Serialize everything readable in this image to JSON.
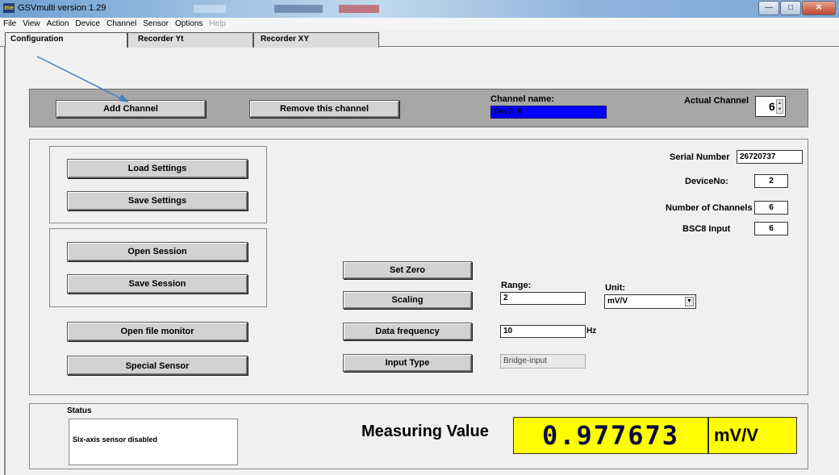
{
  "window": {
    "title": "GSVmulti version 1.29",
    "logo": "me"
  },
  "menu": [
    {
      "label": "File",
      "enabled": true
    },
    {
      "label": "View",
      "enabled": true
    },
    {
      "label": "Action",
      "enabled": true
    },
    {
      "label": "Device",
      "enabled": true
    },
    {
      "label": "Channel",
      "enabled": true
    },
    {
      "label": "Sensor",
      "enabled": true
    },
    {
      "label": "Options",
      "enabled": true
    },
    {
      "label": "Help",
      "enabled": false
    }
  ],
  "tabs": {
    "configuration": "Configuration",
    "recorder_yt": "Recorder Yt",
    "recorder_xy": "Recorder XY"
  },
  "channel_bar": {
    "add_channel": "Add Channel",
    "remove_channel": "Remove this channel",
    "channel_name_label": "Channel name:",
    "channel_name_value": "Dev2_6",
    "actual_channel_label": "Actual Channel",
    "actual_channel_value": "6"
  },
  "settings": {
    "load_settings": "Load Settings",
    "save_settings": "Save Settings",
    "open_session": "Open Session",
    "save_session": "Save Session",
    "open_file_monitor": "Open file monitor",
    "special_sensor": "Special Sensor"
  },
  "device_info": {
    "serial_number_label": "Serial Number",
    "serial_number_value": "26720737",
    "device_no_label": "DeviceNo:",
    "device_no_value": "2",
    "num_channels_label": "Number of Channels",
    "num_channels_value": "6",
    "bsc8_label": "BSC8 Input",
    "bsc8_value": "6"
  },
  "channel_config": {
    "set_zero": "Set Zero",
    "scaling": "Scaling",
    "data_frequency": "Data frequency",
    "input_type": "Input Type",
    "range_label": "Range:",
    "range_value": "2",
    "unit_label": "Unit:",
    "unit_value": "mV/V",
    "frequency_value": "10",
    "frequency_unit": "Hz",
    "input_type_value": "Bridge-input"
  },
  "status": {
    "label": "Status",
    "message": "Six-axis sensor disabled"
  },
  "measuring": {
    "label": "Measuring Value",
    "value": "0.977673",
    "unit": "mV/V"
  },
  "colors": {
    "channel_name_bg": "#0000ff",
    "channel_name_text": "#000040",
    "display_bg": "#ffff00",
    "panel_bar": "#a7a7a7"
  }
}
